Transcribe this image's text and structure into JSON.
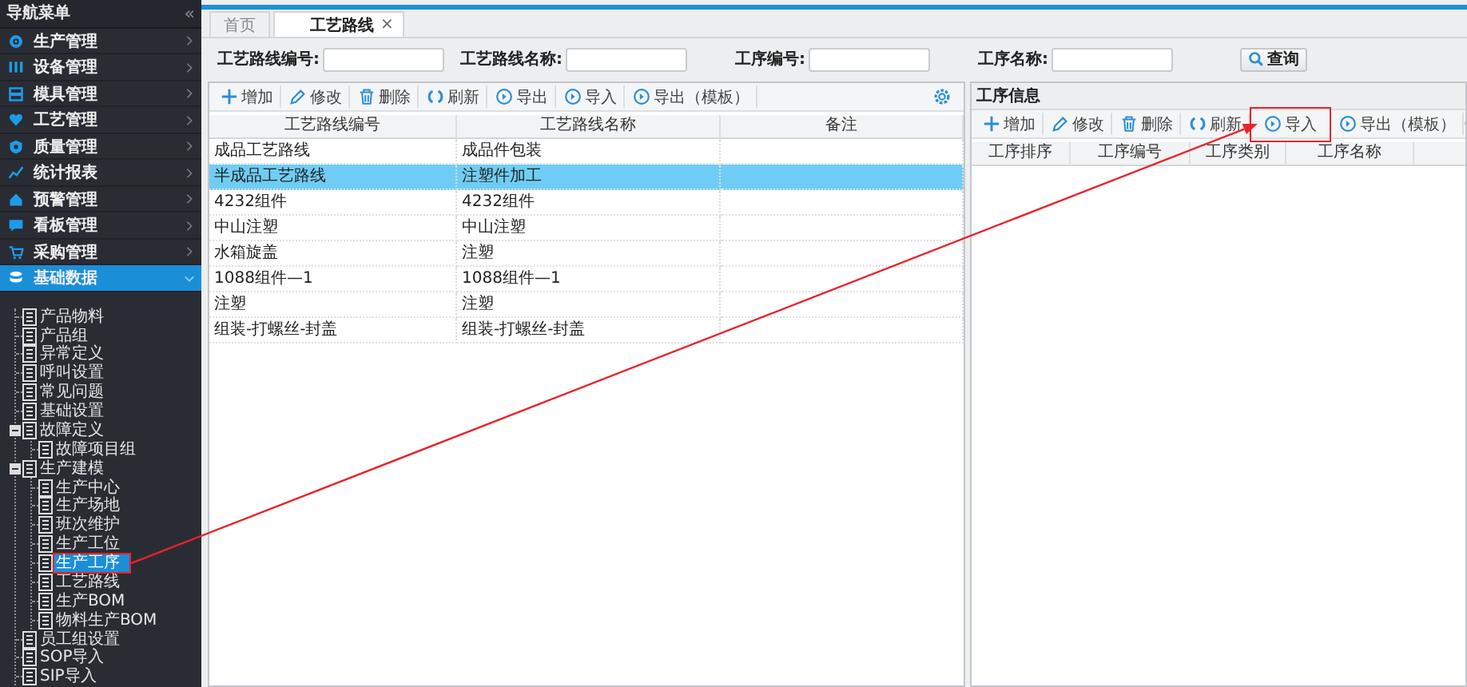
{
  "sidebar": {
    "title": "导航菜单",
    "collapse_glyph": "«",
    "menu": [
      {
        "label": "生产管理",
        "selected": false
      },
      {
        "label": "设备管理",
        "selected": false
      },
      {
        "label": "模具管理",
        "selected": false
      },
      {
        "label": "工艺管理",
        "selected": false
      },
      {
        "label": "质量管理",
        "selected": false
      },
      {
        "label": "统计报表",
        "selected": false
      },
      {
        "label": "预警管理",
        "selected": false
      },
      {
        "label": "看板管理",
        "selected": false
      },
      {
        "label": "采购管理",
        "selected": false
      },
      {
        "label": "基础数据",
        "selected": true
      }
    ],
    "tree": [
      {
        "label": "产品物料",
        "selected": false
      },
      {
        "label": "产品组",
        "selected": false
      },
      {
        "label": "异常定义",
        "selected": false
      },
      {
        "label": "呼叫设置",
        "selected": false
      },
      {
        "label": "常见问题",
        "selected": false
      },
      {
        "label": "基础设置",
        "selected": false
      },
      {
        "label": "故障定义",
        "selected": false,
        "expanded": true,
        "children": [
          {
            "label": "故障项目组",
            "selected": false
          }
        ]
      },
      {
        "label": "生产建模",
        "selected": false,
        "expanded": true,
        "children": [
          {
            "label": "生产中心",
            "selected": false
          },
          {
            "label": "生产场地",
            "selected": false
          },
          {
            "label": "班次维护",
            "selected": false
          },
          {
            "label": "生产工位",
            "selected": false
          },
          {
            "label": "生产工序",
            "selected": true,
            "highlighted": true
          },
          {
            "label": "工艺路线",
            "selected": false
          },
          {
            "label": "生产BOM",
            "selected": false
          },
          {
            "label": "物料生产BOM",
            "selected": false
          }
        ]
      },
      {
        "label": "员工组设置",
        "selected": false
      },
      {
        "label": "SOP导入",
        "selected": false
      },
      {
        "label": "SIP导入",
        "selected": false
      }
    ]
  },
  "tabs": [
    {
      "label": "首页",
      "selected": false
    },
    {
      "label": "工艺路线",
      "selected": true,
      "close": "×"
    }
  ],
  "search": {
    "fields": [
      {
        "label": "工艺路线编号:"
      },
      {
        "label": "工艺路线名称:"
      },
      {
        "label": "工序编号:"
      },
      {
        "label": "工序名称:"
      }
    ],
    "button": "查询"
  },
  "route_panel": {
    "toolbar": [
      {
        "kind": "add",
        "label": "增加"
      },
      {
        "kind": "edit",
        "label": "修改"
      },
      {
        "kind": "delete",
        "label": "删除"
      },
      {
        "kind": "refresh",
        "label": "刷新"
      },
      {
        "kind": "export",
        "label": "导出"
      },
      {
        "kind": "import",
        "label": "导入"
      },
      {
        "kind": "export",
        "label": "导出（模板）"
      }
    ],
    "columns": [
      "工艺路线编号",
      "工艺路线名称",
      "备注"
    ],
    "rows": [
      {
        "cells": [
          "成品工艺路线",
          "成品件包装"
        ],
        "selected": false
      },
      {
        "cells": [
          "半成品工艺路线",
          "注塑件加工"
        ],
        "selected": true
      },
      {
        "cells": [
          "4232组件",
          "4232组件"
        ],
        "selected": false
      },
      {
        "cells": [
          "中山注塑",
          "中山注塑"
        ],
        "selected": false
      },
      {
        "cells": [
          "水箱旋盖",
          "注塑"
        ],
        "selected": false
      },
      {
        "cells": [
          "1088组件—1",
          "1088组件—1"
        ],
        "selected": false
      },
      {
        "cells": [
          "注塑",
          "注塑"
        ],
        "selected": false
      },
      {
        "cells": [
          "组装-打螺丝-封盖",
          "组装-打螺丝-封盖"
        ],
        "selected": false
      }
    ]
  },
  "process_panel": {
    "title": "工序信息",
    "toolbar": [
      {
        "kind": "add",
        "label": "增加"
      },
      {
        "kind": "edit",
        "label": "修改"
      },
      {
        "kind": "delete",
        "label": "删除"
      },
      {
        "kind": "refresh",
        "label": "刷新"
      },
      {
        "kind": "import",
        "label": "导入",
        "highlighted": true
      },
      {
        "kind": "export",
        "label": "导出（模板）"
      }
    ],
    "columns": [
      "工序排序",
      "工序编号",
      "工序类别",
      "工序名称"
    ]
  },
  "annotation": {
    "arrow": true
  }
}
